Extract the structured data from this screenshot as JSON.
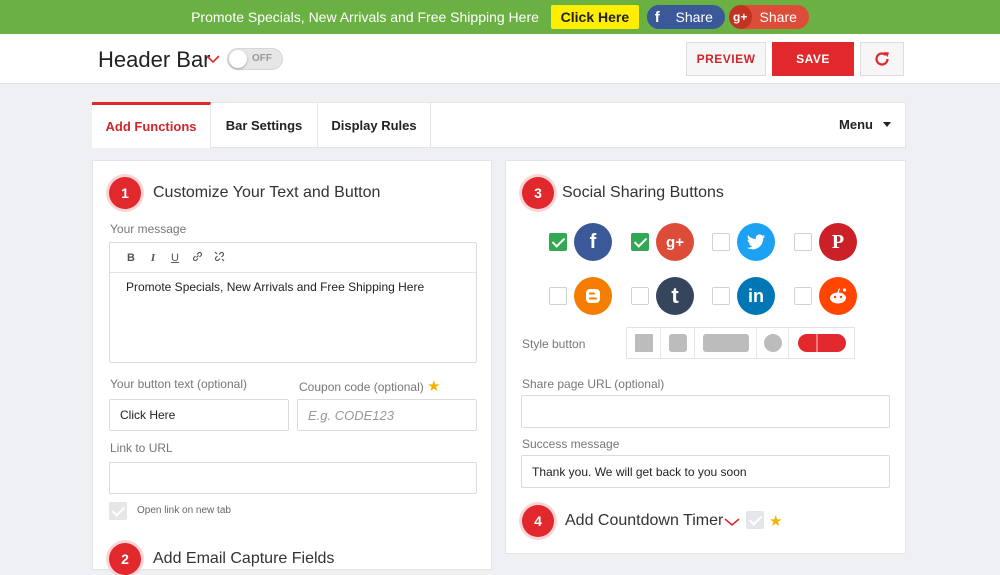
{
  "promo": {
    "text": "Promote Specials, New Arrivals and Free Shipping Here",
    "button": "Click Here",
    "fb_label": "Share",
    "gp_label": "Share"
  },
  "header": {
    "title": "Header Bar",
    "toggle": "OFF",
    "preview": "PREVIEW",
    "save": "SAVE"
  },
  "tabs": {
    "items": [
      "Add Functions",
      "Bar Settings",
      "Display Rules"
    ],
    "menu": "Menu"
  },
  "left": {
    "step1_num": "1",
    "step1_title": "Customize Your Text and Button",
    "message_label": "Your message",
    "message_value": "Promote Specials, New Arrivals and Free Shipping Here",
    "button_text_label": "Your button text (optional)",
    "button_text_value": "Click Here",
    "coupon_label": "Coupon code (optional)",
    "coupon_placeholder": "E.g. CODE123",
    "link_label": "Link to URL",
    "link_value": "",
    "newtab_label": "Open link on new tab",
    "step2_num": "2",
    "step2_title": "Add Email Capture Fields"
  },
  "right": {
    "step3_num": "3",
    "step3_title": "Social Sharing Buttons",
    "networks": [
      {
        "name": "facebook",
        "checked": true,
        "color": "#3b5998"
      },
      {
        "name": "google-plus",
        "checked": true,
        "color": "#dd4b39"
      },
      {
        "name": "twitter",
        "checked": false,
        "color": "#1da1f2"
      },
      {
        "name": "pinterest",
        "checked": false,
        "color": "#cb2027"
      },
      {
        "name": "blogger",
        "checked": false,
        "color": "#f57d00"
      },
      {
        "name": "tumblr",
        "checked": false,
        "color": "#35465c"
      },
      {
        "name": "linkedin",
        "checked": false,
        "color": "#0077b5"
      },
      {
        "name": "reddit",
        "checked": false,
        "color": "#ff4500"
      }
    ],
    "style_label": "Style button",
    "share_url_label": "Share page URL (optional)",
    "share_url_value": "",
    "success_label": "Success message",
    "success_value": "Thank you. We will get back to you soon",
    "step4_num": "4",
    "step4_title": "Add Countdown Timer"
  },
  "colors": {
    "accent": "#e0282d",
    "promo_bg": "#6ab043",
    "check_on": "#32a852"
  }
}
